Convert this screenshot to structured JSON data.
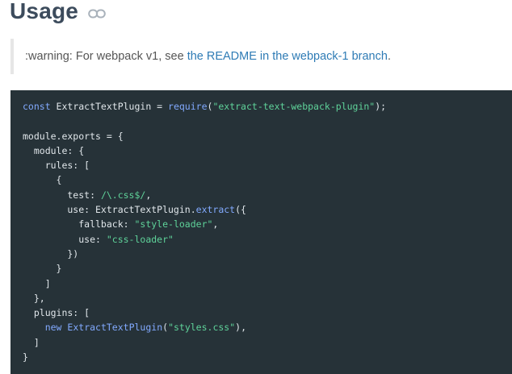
{
  "heading": {
    "title": "Usage",
    "icon": "link-icon"
  },
  "note": {
    "prefix": ":warning: For webpack v1, see ",
    "link_text": "the README in the webpack-1 branch",
    "suffix": "."
  },
  "code": {
    "lines": [
      [
        {
          "t": "kw",
          "v": "const"
        },
        {
          "t": "pl",
          "v": " ExtractTextPlugin = "
        },
        {
          "t": "fn",
          "v": "require"
        },
        {
          "t": "pl",
          "v": "("
        },
        {
          "t": "str",
          "v": "\"extract-text-webpack-plugin\""
        },
        {
          "t": "pl",
          "v": ");"
        }
      ],
      [],
      [
        {
          "t": "pl",
          "v": "module.exports = {"
        }
      ],
      [
        {
          "t": "pl",
          "v": "  module: {"
        }
      ],
      [
        {
          "t": "pl",
          "v": "    rules: ["
        }
      ],
      [
        {
          "t": "pl",
          "v": "      {"
        }
      ],
      [
        {
          "t": "pl",
          "v": "        test: "
        },
        {
          "t": "re",
          "v": "/\\.css$/"
        },
        {
          "t": "pl",
          "v": ","
        }
      ],
      [
        {
          "t": "pl",
          "v": "        use: ExtractTextPlugin."
        },
        {
          "t": "fn",
          "v": "extract"
        },
        {
          "t": "pl",
          "v": "({"
        }
      ],
      [
        {
          "t": "pl",
          "v": "          fallback: "
        },
        {
          "t": "str",
          "v": "\"style-loader\""
        },
        {
          "t": "pl",
          "v": ","
        }
      ],
      [
        {
          "t": "pl",
          "v": "          use: "
        },
        {
          "t": "str",
          "v": "\"css-loader\""
        }
      ],
      [
        {
          "t": "pl",
          "v": "        })"
        }
      ],
      [
        {
          "t": "pl",
          "v": "      }"
        }
      ],
      [
        {
          "t": "pl",
          "v": "    ]"
        }
      ],
      [
        {
          "t": "pl",
          "v": "  },"
        }
      ],
      [
        {
          "t": "pl",
          "v": "  plugins: ["
        }
      ],
      [
        {
          "t": "pl",
          "v": "    "
        },
        {
          "t": "kw",
          "v": "new"
        },
        {
          "t": "pl",
          "v": " "
        },
        {
          "t": "fn",
          "v": "ExtractTextPlugin"
        },
        {
          "t": "pl",
          "v": "("
        },
        {
          "t": "str",
          "v": "\"styles.css\""
        },
        {
          "t": "pl",
          "v": "),"
        }
      ],
      [
        {
          "t": "pl",
          "v": "  ]"
        }
      ],
      [
        {
          "t": "pl",
          "v": "}"
        }
      ]
    ]
  },
  "colors": {
    "heading": "#3c4b5c",
    "link": "#2e7bb5",
    "code_bg": "#263238",
    "keyword": "#82aaff",
    "string": "#5fd39a"
  }
}
